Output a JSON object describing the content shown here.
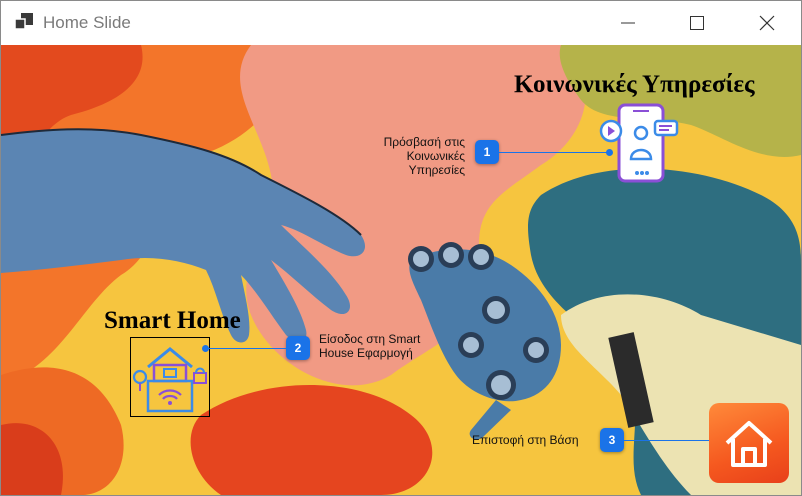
{
  "window": {
    "title": "Home Slide"
  },
  "social_services": {
    "heading": "Κοινωνικές Υπηρεσίες",
    "callout_number": "1",
    "callout_line1": "Πρόσβασή στις",
    "callout_line2": "Κοινωνικές Υπηρεσίες"
  },
  "smart_home": {
    "heading": "Smart Home",
    "callout_number": "2",
    "callout_line1": "Είσοδος στη Smart",
    "callout_line2": "House Εφαρμογή"
  },
  "back": {
    "callout_number": "3",
    "callout_text": "Επιστοφή στη Βάση"
  },
  "colors": {
    "accent": "#1a73e8",
    "home_tile": "#f5581f"
  },
  "icons": [
    "app-icon",
    "minimize-icon",
    "maximize-icon",
    "close-icon",
    "social-services-phone-icon",
    "smart-home-icon",
    "home-icon"
  ]
}
